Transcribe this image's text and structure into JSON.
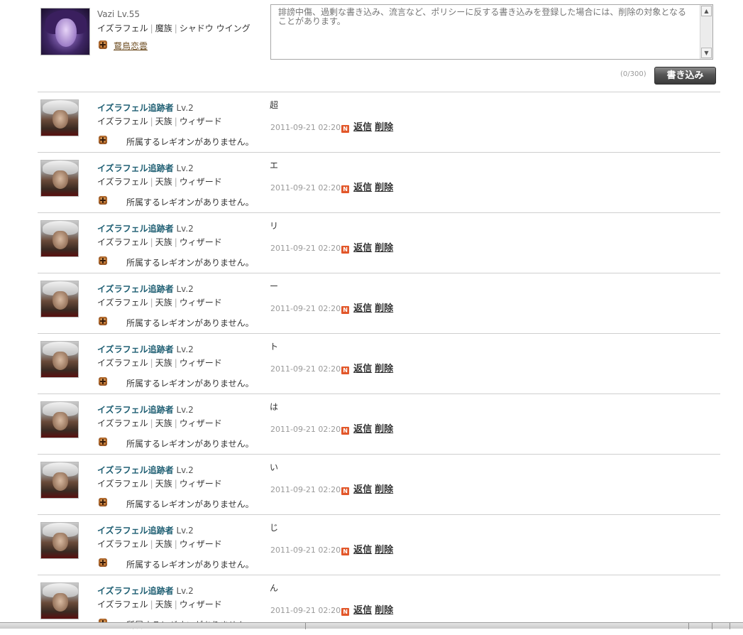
{
  "composer": {
    "user_name": "Vazi",
    "user_level": "Lv.55",
    "server": "イズラフェル",
    "race": "魔族",
    "class": "シャドウ ウイング",
    "legion_name": "鵞鳥恋雲",
    "placeholder": "誹謗中傷、過剰な書き込み、流言など、ポリシーに反する書き込みを登録した場合には、削除の対象となることがあります。",
    "counter": "(0/300)",
    "submit_label": "書き込み"
  },
  "colors": {
    "name_link": "#1f5f73",
    "new_badge": "#e2572a",
    "button_dark": "#3a3a3a"
  },
  "icons": {
    "legion": "legion-emblem-icon",
    "new": "new-badge-icon",
    "scroll_up": "arrow-up-icon",
    "scroll_down": "arrow-down-icon"
  },
  "comments": [
    {
      "name": "イズラフェル追跡者",
      "level": "Lv.2",
      "server": "イズラフェル",
      "race": "天族",
      "class": "ウィザード",
      "legion": "所属するレギオンがありません。",
      "text": "超",
      "date": "2011-09-21 02:20",
      "new_badge": "N",
      "reply_label": "返信",
      "delete_label": "削除"
    },
    {
      "name": "イズラフェル追跡者",
      "level": "Lv.2",
      "server": "イズラフェル",
      "race": "天族",
      "class": "ウィザード",
      "legion": "所属するレギオンがありません。",
      "text": "エ",
      "date": "2011-09-21 02:20",
      "new_badge": "N",
      "reply_label": "返信",
      "delete_label": "削除"
    },
    {
      "name": "イズラフェル追跡者",
      "level": "Lv.2",
      "server": "イズラフェル",
      "race": "天族",
      "class": "ウィザード",
      "legion": "所属するレギオンがありません。",
      "text": "リ",
      "date": "2011-09-21 02:20",
      "new_badge": "N",
      "reply_label": "返信",
      "delete_label": "削除"
    },
    {
      "name": "イズラフェル追跡者",
      "level": "Lv.2",
      "server": "イズラフェル",
      "race": "天族",
      "class": "ウィザード",
      "legion": "所属するレギオンがありません。",
      "text": "ー",
      "date": "2011-09-21 02:20",
      "new_badge": "N",
      "reply_label": "返信",
      "delete_label": "削除"
    },
    {
      "name": "イズラフェル追跡者",
      "level": "Lv.2",
      "server": "イズラフェル",
      "race": "天族",
      "class": "ウィザード",
      "legion": "所属するレギオンがありません。",
      "text": "ト",
      "date": "2011-09-21 02:20",
      "new_badge": "N",
      "reply_label": "返信",
      "delete_label": "削除"
    },
    {
      "name": "イズラフェル追跡者",
      "level": "Lv.2",
      "server": "イズラフェル",
      "race": "天族",
      "class": "ウィザード",
      "legion": "所属するレギオンがありません。",
      "text": "は",
      "date": "2011-09-21 02:20",
      "new_badge": "N",
      "reply_label": "返信",
      "delete_label": "削除"
    },
    {
      "name": "イズラフェル追跡者",
      "level": "Lv.2",
      "server": "イズラフェル",
      "race": "天族",
      "class": "ウィザード",
      "legion": "所属するレギオンがありません。",
      "text": "い",
      "date": "2011-09-21 02:20",
      "new_badge": "N",
      "reply_label": "返信",
      "delete_label": "削除"
    },
    {
      "name": "イズラフェル追跡者",
      "level": "Lv.2",
      "server": "イズラフェル",
      "race": "天族",
      "class": "ウィザード",
      "legion": "所属するレギオンがありません。",
      "text": "じ",
      "date": "2011-09-21 02:20",
      "new_badge": "N",
      "reply_label": "返信",
      "delete_label": "削除"
    },
    {
      "name": "イズラフェル追跡者",
      "level": "Lv.2",
      "server": "イズラフェル",
      "race": "天族",
      "class": "ウィザード",
      "legion": "所属するレギオンがありません。",
      "text": "ん",
      "date": "2011-09-21 02:20",
      "new_badge": "N",
      "reply_label": "返信",
      "delete_label": "削除"
    }
  ]
}
